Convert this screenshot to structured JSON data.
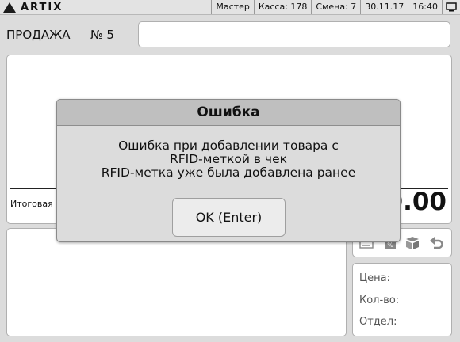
{
  "statusbar": {
    "brand": "ARTIX",
    "user": "Мастер",
    "register": "Касса: 178",
    "shift": "Смена: 7",
    "date": "30.11.17",
    "time": "16:40"
  },
  "sale": {
    "title": "ПРОДАЖА",
    "number": "№ 5",
    "search": {
      "value": ""
    }
  },
  "receipt": {
    "total_label": "Итоговая",
    "total_value": "0.00"
  },
  "info": {
    "price_label": "Цена:",
    "qty_label": "Кол-во:",
    "dept_label": "Отдел:"
  },
  "dialog": {
    "title": "Ошибка",
    "message_line1": "Ошибка при добавлении товара с",
    "message_line2": "RFID-меткой в чек",
    "message_line3": "RFID-метка уже была добавлена ранее",
    "ok_label": "OK (Enter)"
  }
}
